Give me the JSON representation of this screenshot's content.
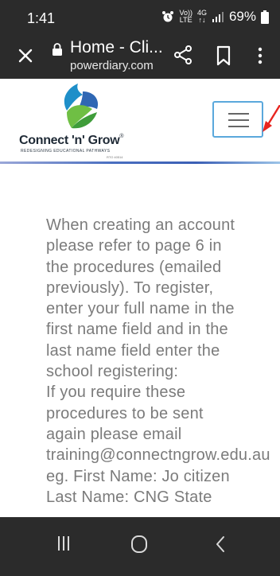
{
  "status_bar": {
    "time": "1:41",
    "volte_top": "Vo))",
    "volte_bottom": "LTE",
    "network_top": "4G",
    "network_bottom": "↑↓",
    "battery_percent": "69%"
  },
  "toolbar": {
    "page_title": "Home - Cli...",
    "domain": "powerdiary.com",
    "icons": [
      "close-icon",
      "lock-icon",
      "share-icon",
      "bookmark-icon",
      "more-vertical-icon"
    ]
  },
  "site_header": {
    "logo_name": "Connect 'n' Grow",
    "logo_registered": "®",
    "logo_tagline": "REDESIGNING EDUCATIONAL PATHWAYS",
    "logo_rto": "RTO 40514",
    "menu_icon": "hamburger-icon",
    "accent_color": "#5aa8dc",
    "annotation_color": "#e8251f"
  },
  "content": {
    "lines": [
      "When creating an account",
      "please refer to page 6 in",
      "the procedures (emailed",
      "previously). To register,",
      "enter your full name in the",
      "first name field and in the",
      "last name field enter the",
      "school registering:",
      "If you require these",
      "procedures to be sent",
      "again please email",
      "training@connectngrow.edu.au",
      "eg. First Name: Jo citizen",
      "Last Name: CNG State"
    ]
  },
  "nav_bar": {
    "icons": [
      "recent-apps-icon",
      "home-icon",
      "back-icon"
    ]
  }
}
